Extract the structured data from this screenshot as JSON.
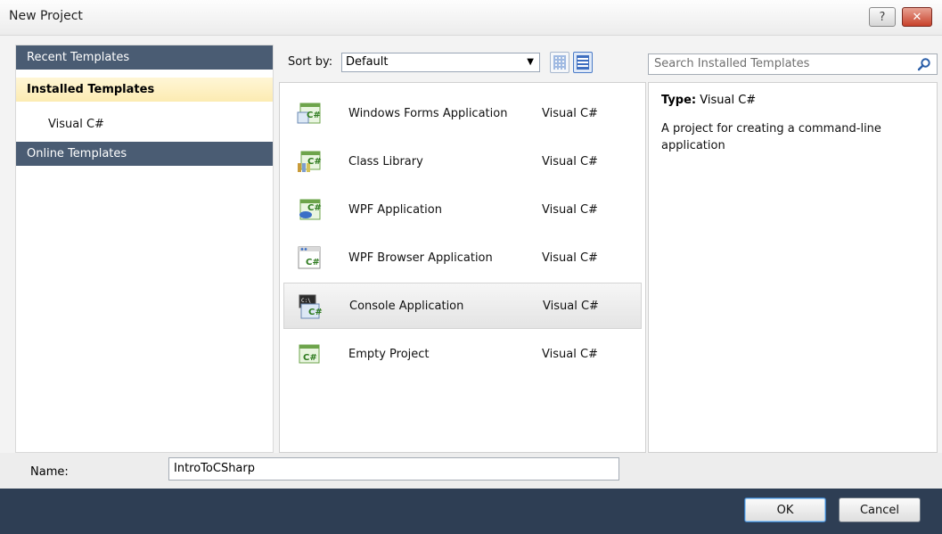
{
  "window": {
    "title": "New Project",
    "help_glyph": "?",
    "close_glyph": "✕"
  },
  "left_nav": {
    "recent": "Recent Templates",
    "installed": "Installed Templates",
    "visual_cs": "Visual C#",
    "online": "Online Templates"
  },
  "sort": {
    "label": "Sort by:",
    "value": "Default",
    "arrow": "▼"
  },
  "templates": [
    {
      "name": "Windows Forms Application",
      "language": "Visual C#"
    },
    {
      "name": "Class Library",
      "language": "Visual C#"
    },
    {
      "name": "WPF Application",
      "language": "Visual C#"
    },
    {
      "name": "WPF Browser Application",
      "language": "Visual C#"
    },
    {
      "name": "Console Application",
      "language": "Visual C#"
    },
    {
      "name": "Empty Project",
      "language": "Visual C#"
    }
  ],
  "selected_template_index": 4,
  "search": {
    "placeholder": "Search Installed Templates"
  },
  "info": {
    "type_label": "Type:",
    "type_value": "Visual C#",
    "description": "A project for creating a command-line application"
  },
  "name_field": {
    "label": "Name:",
    "value": "IntroToCSharp"
  },
  "buttons": {
    "ok": "OK",
    "cancel": "Cancel"
  },
  "icons": {
    "icon_cs_glyph": "C#",
    "console_glyph": "C:\\"
  }
}
